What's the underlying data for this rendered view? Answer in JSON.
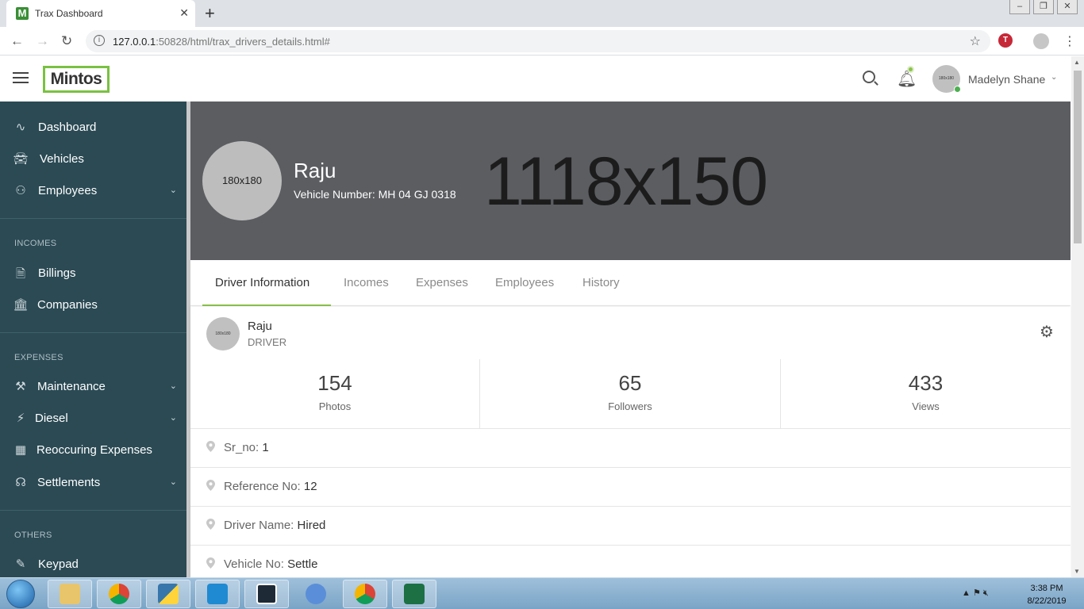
{
  "browser": {
    "tab_title": "Trax Dashboard",
    "favicon_letter": "M",
    "url_host": "127.0.0.1",
    "url_rest": ":50828/html/trax_drivers_details.html#"
  },
  "header": {
    "logo": "Mintos",
    "user_name": "Madelyn Shane",
    "avatar_text": "180x180"
  },
  "sidebar": {
    "items": [
      {
        "label": "Dashboard",
        "icon": "pulse-icon"
      },
      {
        "label": "Vehicles",
        "icon": "car-icon"
      },
      {
        "label": "Employees",
        "icon": "users-icon",
        "has_caret": true
      }
    ],
    "incomes_title": "INCOMES",
    "incomes": [
      {
        "label": "Billings",
        "icon": "file-icon"
      },
      {
        "label": "Companies",
        "icon": "bank-icon"
      }
    ],
    "expenses_title": "EXPENSES",
    "expenses": [
      {
        "label": "Maintenance",
        "icon": "wrench-icon",
        "has_caret": true
      },
      {
        "label": "Diesel",
        "icon": "bolt-icon",
        "has_caret": true
      },
      {
        "label": "Reoccuring Expenses",
        "icon": "chart-icon"
      },
      {
        "label": "Settlements",
        "icon": "headset-icon",
        "has_caret": true
      }
    ],
    "others_title": "OTHERS",
    "others": [
      {
        "label": "Keypad",
        "icon": "pencil-icon"
      }
    ]
  },
  "banner": {
    "avatar_text": "180x180",
    "name": "Raju",
    "vehicle_label": "Vehicle Number:",
    "vehicle_value": "MH 04 GJ 0318",
    "placeholder_text": "1118x150"
  },
  "tabs": [
    "Driver Information",
    "Incomes",
    "Expenses",
    "Employees",
    "History"
  ],
  "profile": {
    "avatar_text": "180x180",
    "name": "Raju",
    "role": "DRIVER"
  },
  "stats": [
    {
      "value": "154",
      "label": "Photos"
    },
    {
      "value": "65",
      "label": "Followers"
    },
    {
      "value": "433",
      "label": "Views"
    }
  ],
  "details": [
    {
      "label": "Sr_no:",
      "value": "1"
    },
    {
      "label": "Reference No:",
      "value": "12"
    },
    {
      "label": "Driver Name:",
      "value": "Hired"
    },
    {
      "label": "Vehicle No:",
      "value": "Settle"
    }
  ],
  "taskbar": {
    "time": "3:38 PM",
    "date": "8/22/2019"
  },
  "colors": {
    "sidebar_bg": "#2b4a54",
    "accent_green": "#8bc34a",
    "banner_bg": "#5b5d61"
  }
}
